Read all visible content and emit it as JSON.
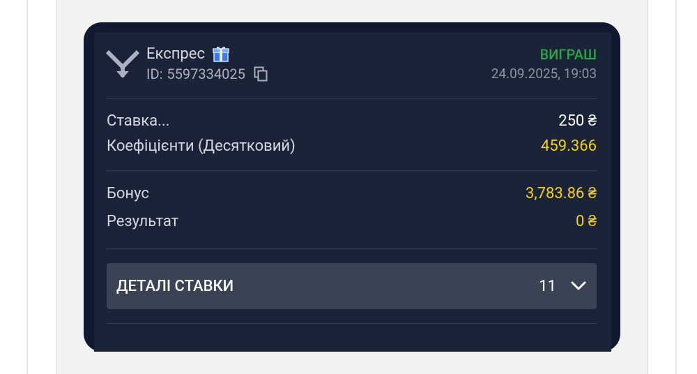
{
  "bet": {
    "type": "Експрес",
    "id_label": "ID:",
    "id_value": "5597334025",
    "status": "ВИГРАШ",
    "datetime": "24.09.2025, 19:03"
  },
  "stake": {
    "label": "Ставка...",
    "value": "250 ₴"
  },
  "odds": {
    "label": "Коефіцієнти (Десятковий)",
    "value": "459.366"
  },
  "bonus": {
    "label": "Бонус",
    "value": "3,783.86 ₴"
  },
  "result": {
    "label": "Результат",
    "value": "0 ₴"
  },
  "details": {
    "label": "ДЕТАЛІ СТАВКИ",
    "count": "11"
  },
  "colors": {
    "card_bg": "#1a2338",
    "status_green": "#27a845",
    "accent_yellow": "#f5d20f",
    "details_bg": "#3a4356"
  },
  "icons": [
    "express-logo-icon",
    "gift-icon",
    "copy-icon",
    "chevron-down-icon"
  ]
}
